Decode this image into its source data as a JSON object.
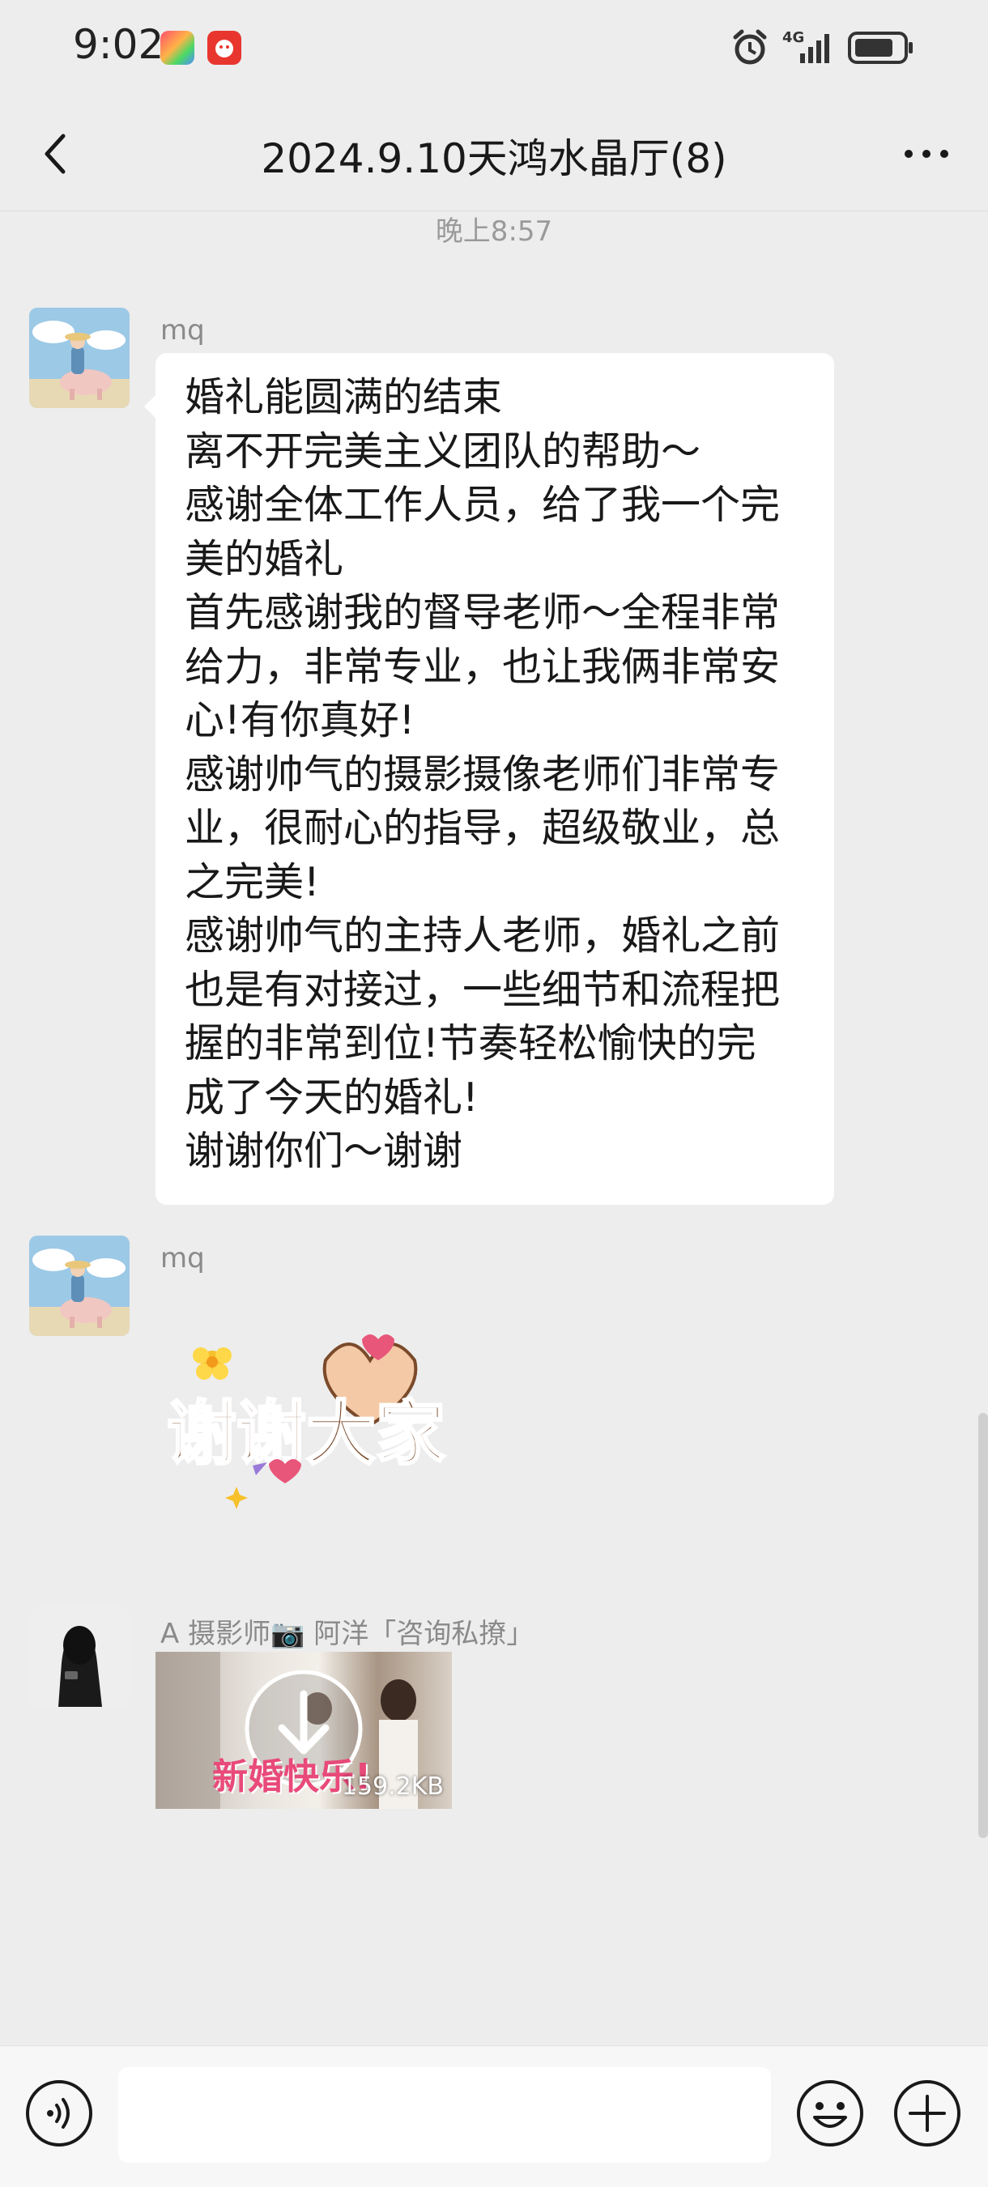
{
  "status_bar": {
    "time": "9:02",
    "network": "4G"
  },
  "header": {
    "title": "2024.9.10天鸿水晶厅(8)"
  },
  "timestamp": "晚上8:57",
  "messages": [
    {
      "sender": "mq",
      "avatar": "girl-riding-pig-avatar",
      "type": "text",
      "text": "婚礼能圆满的结束\n离不开完美主义团队的帮助～\n感谢全体工作人员，给了我一个完\n美的婚礼\n首先感谢我的督导老师～全程非常\n给力，非常专业，也让我俩非常安\n心!有你真好!\n感谢帅气的摄影摄像老师们非常专\n业，很耐心的指导，超级敬业，总\n之完美!\n感谢帅气的主持人老师，婚礼之前\n也是有对接过，一些细节和流程把\n握的非常到位!节奏轻松愉快的完\n成了今天的婚礼!\n谢谢你们～谢谢"
    },
    {
      "sender": "mq",
      "avatar": "girl-riding-pig-avatar",
      "type": "sticker",
      "sticker_text": "谢谢大家"
    },
    {
      "sender": "A  摄影师📷 阿洋「咨询私撩」",
      "avatar": "hooded-figure-avatar",
      "type": "media",
      "media_caption": "新婚快乐!",
      "media_size": "159.2KB"
    }
  ],
  "icons": {
    "back": "back-arrow-icon",
    "more": "more-dots-icon",
    "voice": "voice-icon",
    "emoji": "emoji-icon",
    "plus": "plus-icon",
    "download": "download-icon"
  },
  "colors": {
    "background": "#ededed",
    "bubble": "#ffffff",
    "sticker_text": "#7a4a2a",
    "sticker_heart": "#e8567a"
  },
  "input": {
    "value": ""
  }
}
